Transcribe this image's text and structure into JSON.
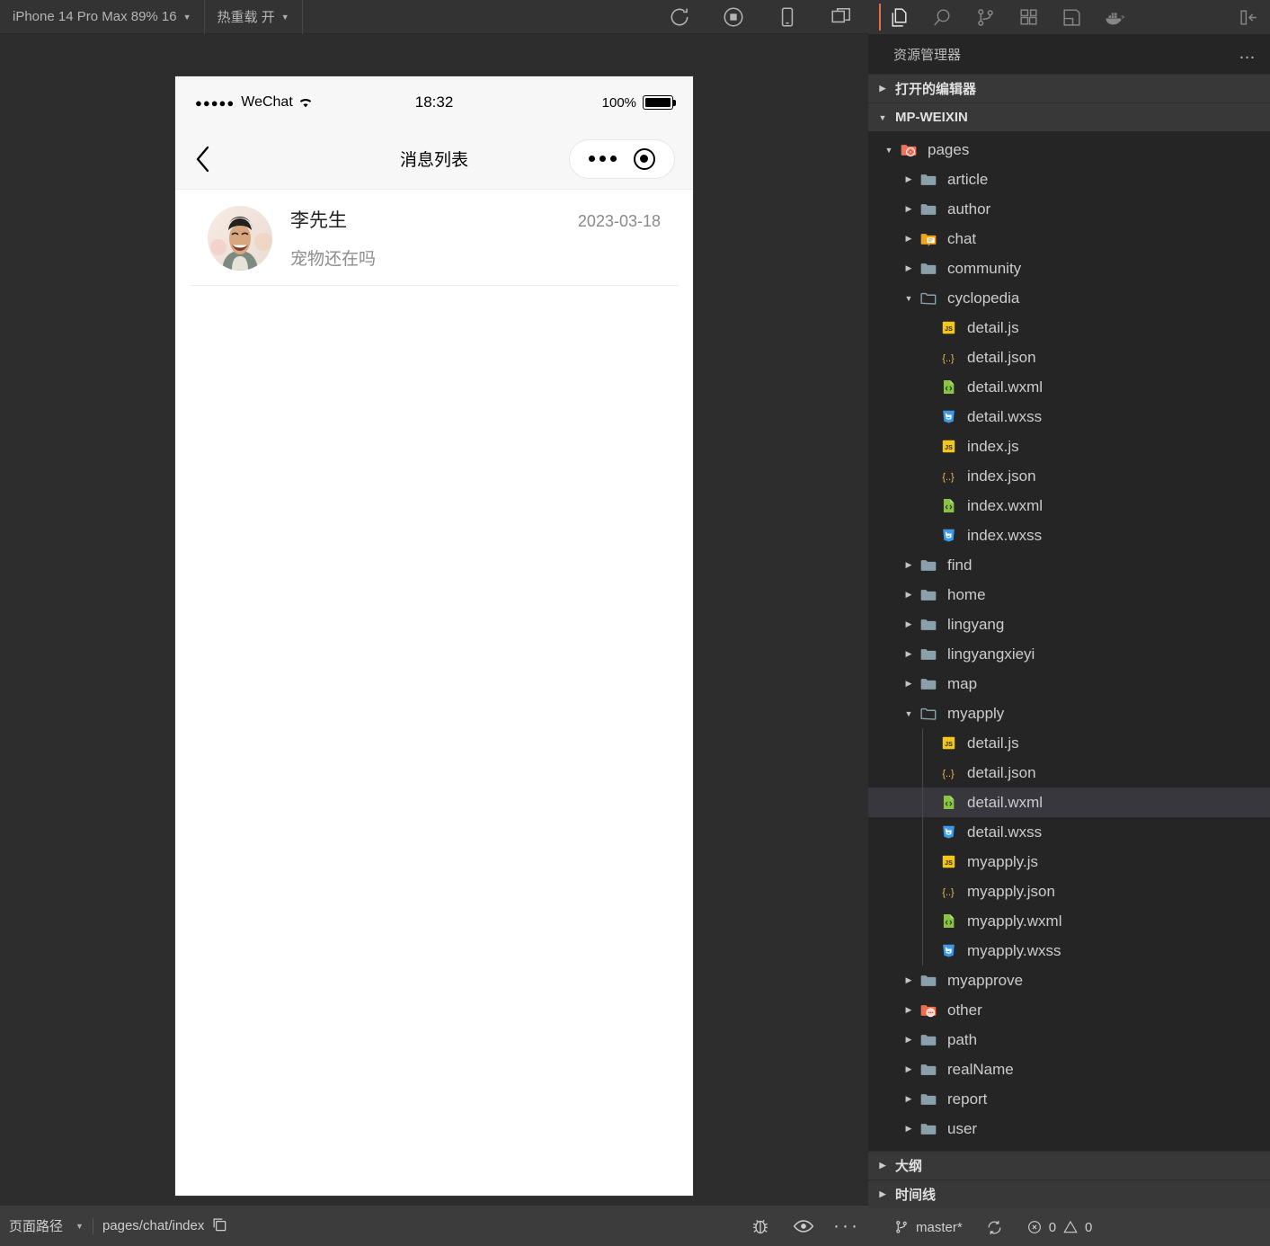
{
  "simulator": {
    "toolbar": {
      "device_label": "iPhone 14 Pro Max 89% 16",
      "hotreload_label": "热重载 开",
      "icons": [
        "refresh-icon",
        "stop-record-icon",
        "phone-icon",
        "windows-icon"
      ]
    },
    "phone": {
      "statusbar": {
        "carrier": "WeChat",
        "signal_dots": "●●●●●",
        "time": "18:32",
        "battery_percent": "100%"
      },
      "navbar": {
        "title": "消息列表",
        "back_icon": "chevron-left-icon",
        "capsule": [
          "more-dots-icon",
          "target-circle-icon"
        ]
      },
      "messages": [
        {
          "name": "李先生",
          "date": "2023-03-18",
          "preview": "宠物还在吗",
          "avatar": "user-avatar"
        }
      ]
    },
    "statusbar": {
      "page_path_label": "页面路径",
      "page_path_value": "pages/chat/index",
      "copy_icon": "copy-icon",
      "right_icons": [
        "bug-icon",
        "eye-icon",
        "ellipsis-icon"
      ]
    }
  },
  "vscode": {
    "activitybar": {
      "items": [
        {
          "name": "explorer-icon",
          "active": true
        },
        {
          "name": "search-icon",
          "active": false
        },
        {
          "name": "source-control-icon",
          "active": false
        },
        {
          "name": "extensions-icon",
          "active": false
        },
        {
          "name": "layout-panel-icon",
          "active": false
        },
        {
          "name": "docker-icon",
          "active": false
        }
      ],
      "collapse_label": "toggle-sidebar-icon"
    },
    "explorer": {
      "title": "资源管理器",
      "more_label": "…",
      "sections": [
        {
          "label": "打开的编辑器",
          "expanded": false
        },
        {
          "label": "MP-WEIXIN",
          "expanded": true
        }
      ],
      "bottom_sections": [
        {
          "label": "大纲",
          "expanded": false
        },
        {
          "label": "时间线",
          "expanded": false
        }
      ],
      "tree": [
        {
          "label": "pages",
          "depth": 1,
          "type": "folder-open-special",
          "twisty": "down",
          "selected": false
        },
        {
          "label": "article",
          "depth": 2,
          "type": "folder",
          "twisty": "right",
          "selected": false
        },
        {
          "label": "author",
          "depth": 2,
          "type": "folder",
          "twisty": "right",
          "selected": false
        },
        {
          "label": "chat",
          "depth": 2,
          "type": "folder-chat",
          "twisty": "right",
          "selected": false
        },
        {
          "label": "community",
          "depth": 2,
          "type": "folder",
          "twisty": "right",
          "selected": false
        },
        {
          "label": "cyclopedia",
          "depth": 2,
          "type": "folder-open",
          "twisty": "down",
          "selected": false
        },
        {
          "label": "detail.js",
          "depth": 3,
          "type": "js",
          "twisty": "none",
          "selected": false
        },
        {
          "label": "detail.json",
          "depth": 3,
          "type": "json",
          "twisty": "none",
          "selected": false
        },
        {
          "label": "detail.wxml",
          "depth": 3,
          "type": "wxml",
          "twisty": "none",
          "selected": false
        },
        {
          "label": "detail.wxss",
          "depth": 3,
          "type": "wxss",
          "twisty": "none",
          "selected": false
        },
        {
          "label": "index.js",
          "depth": 3,
          "type": "js",
          "twisty": "none",
          "selected": false
        },
        {
          "label": "index.json",
          "depth": 3,
          "type": "json",
          "twisty": "none",
          "selected": false
        },
        {
          "label": "index.wxml",
          "depth": 3,
          "type": "wxml",
          "twisty": "none",
          "selected": false
        },
        {
          "label": "index.wxss",
          "depth": 3,
          "type": "wxss",
          "twisty": "none",
          "selected": false
        },
        {
          "label": "find",
          "depth": 2,
          "type": "folder",
          "twisty": "right",
          "selected": false
        },
        {
          "label": "home",
          "depth": 2,
          "type": "folder",
          "twisty": "right",
          "selected": false
        },
        {
          "label": "lingyang",
          "depth": 2,
          "type": "folder",
          "twisty": "right",
          "selected": false
        },
        {
          "label": "lingyangxieyi",
          "depth": 2,
          "type": "folder",
          "twisty": "right",
          "selected": false
        },
        {
          "label": "map",
          "depth": 2,
          "type": "folder",
          "twisty": "right",
          "selected": false
        },
        {
          "label": "myapply",
          "depth": 2,
          "type": "folder-open",
          "twisty": "down",
          "selected": false
        },
        {
          "label": "detail.js",
          "depth": 3,
          "type": "js",
          "twisty": "none",
          "selected": false,
          "guide": true
        },
        {
          "label": "detail.json",
          "depth": 3,
          "type": "json",
          "twisty": "none",
          "selected": false,
          "guide": true
        },
        {
          "label": "detail.wxml",
          "depth": 3,
          "type": "wxml",
          "twisty": "none",
          "selected": true,
          "guide": true
        },
        {
          "label": "detail.wxss",
          "depth": 3,
          "type": "wxss",
          "twisty": "none",
          "selected": false,
          "guide": true
        },
        {
          "label": "myapply.js",
          "depth": 3,
          "type": "js",
          "twisty": "none",
          "selected": false,
          "guide": true
        },
        {
          "label": "myapply.json",
          "depth": 3,
          "type": "json",
          "twisty": "none",
          "selected": false,
          "guide": true
        },
        {
          "label": "myapply.wxml",
          "depth": 3,
          "type": "wxml",
          "twisty": "none",
          "selected": false,
          "guide": true
        },
        {
          "label": "myapply.wxss",
          "depth": 3,
          "type": "wxss",
          "twisty": "none",
          "selected": false,
          "guide": true
        },
        {
          "label": "myapprove",
          "depth": 2,
          "type": "folder",
          "twisty": "right",
          "selected": false
        },
        {
          "label": "other",
          "depth": 2,
          "type": "folder-other",
          "twisty": "right",
          "selected": false
        },
        {
          "label": "path",
          "depth": 2,
          "type": "folder",
          "twisty": "right",
          "selected": false
        },
        {
          "label": "realName",
          "depth": 2,
          "type": "folder",
          "twisty": "right",
          "selected": false
        },
        {
          "label": "report",
          "depth": 2,
          "type": "folder",
          "twisty": "right",
          "selected": false
        },
        {
          "label": "user",
          "depth": 2,
          "type": "folder",
          "twisty": "right",
          "selected": false
        }
      ]
    },
    "statusbar": {
      "branch": "master*",
      "sync_icon": "sync-icon",
      "errors": "0",
      "warnings": "0"
    }
  },
  "colors": {
    "accent": "#e06c4a",
    "sidebar_bg": "#252526",
    "selected_row": "#37373d",
    "toolbar_bg": "#333333",
    "statusbar_bg": "#3c3c3c"
  }
}
